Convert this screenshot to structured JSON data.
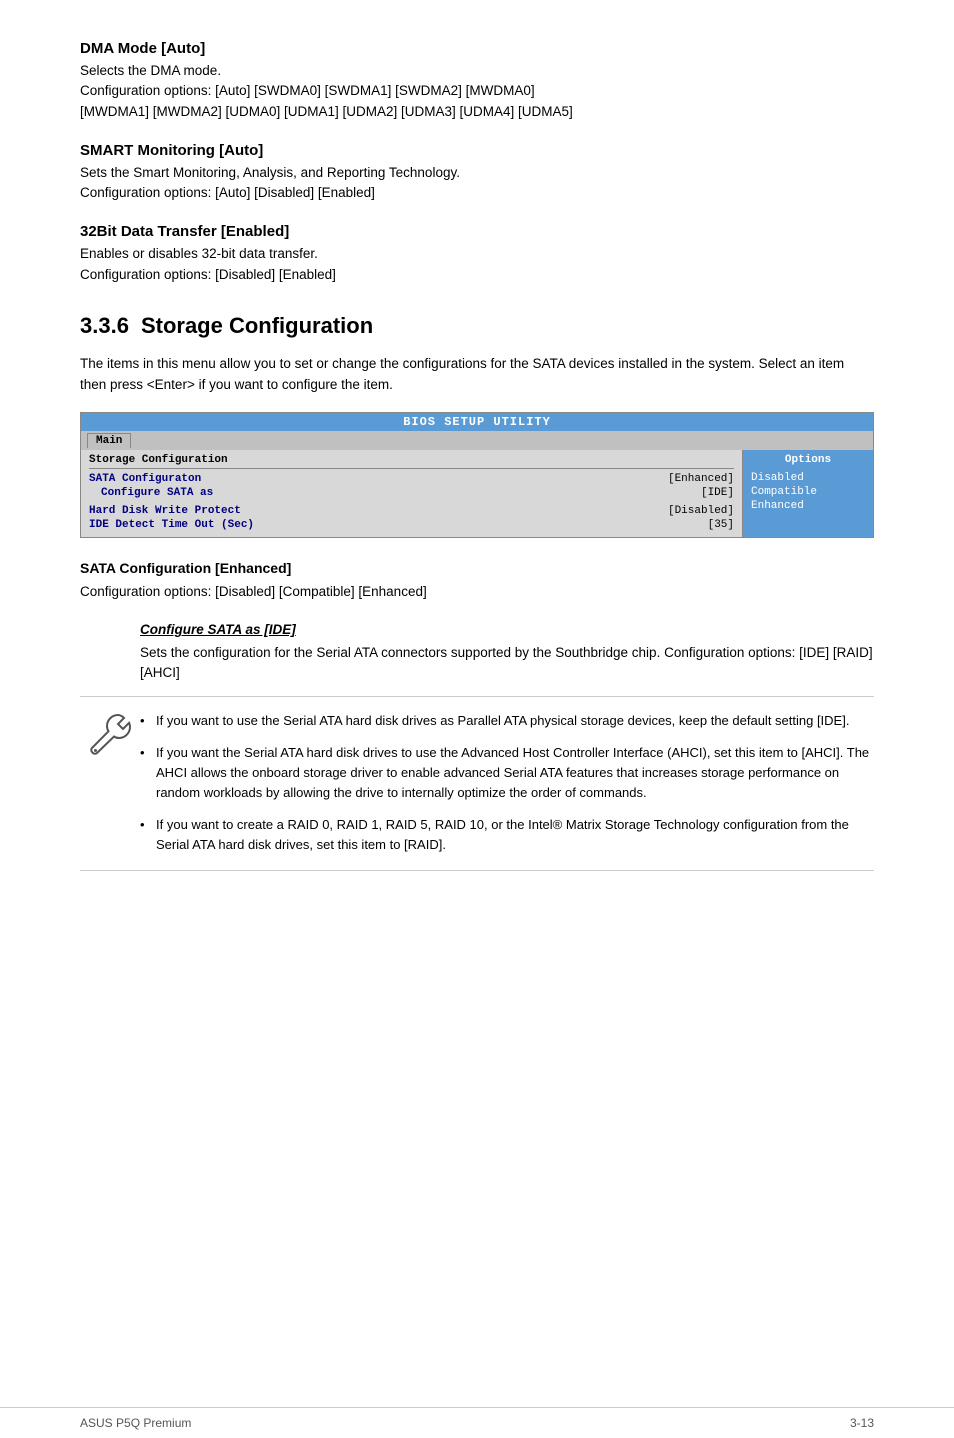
{
  "dma_section": {
    "heading": "DMA Mode [Auto]",
    "body_line1": "Selects the DMA mode.",
    "body_line2": "Configuration options: [Auto] [SWDMA0] [SWDMA1] [SWDMA2] [MWDMA0]",
    "body_line3": "[MWDMA1] [MWDMA2] [UDMA0] [UDMA1] [UDMA2] [UDMA3] [UDMA4] [UDMA5]"
  },
  "smart_section": {
    "heading": "SMART Monitoring [Auto]",
    "body_line1": "Sets the Smart Monitoring, Analysis, and Reporting Technology.",
    "body_line2": "Configuration options: [Auto] [Disabled] [Enabled]"
  },
  "bit32_section": {
    "heading": "32Bit Data Transfer [Enabled]",
    "body_line1": "Enables or disables 32-bit data transfer.",
    "body_line2": "Configuration options: [Disabled] [Enabled]"
  },
  "storage_section": {
    "number": "3.3.6",
    "title": "Storage Configuration",
    "intro": "The items in this menu allow you to set or change the configurations for the SATA devices installed in the system. Select an item then press <Enter> if you want to configure the item."
  },
  "bios_ui": {
    "title": "BIOS SETUP UTILITY",
    "menu_tab": "Main",
    "section_label": "Storage Configuration",
    "options_label": "Options",
    "rows": [
      {
        "label": "SATA Configuraton",
        "value": "[Enhanced]",
        "sublabel": "Configure SATA as",
        "subvalue": "[IDE]"
      },
      {
        "label": "Hard Disk Write Protect",
        "value": "[Disabled]",
        "sublabel": "IDE Detect Time Out (Sec)",
        "subvalue": "[35]"
      }
    ],
    "options": [
      "Disabled",
      "Compatible",
      "Enhanced"
    ]
  },
  "sata_section": {
    "heading": "SATA Configuration [Enhanced]",
    "config_options": "Configuration options: [Disabled] [Compatible] [Enhanced]",
    "configure_label": "Configure SATA as [IDE]",
    "configure_body": "Sets the configuration for the Serial ATA connectors supported by the Southbridge chip. Configuration options: [IDE] [RAID] [AHCI]"
  },
  "notes": [
    "If you want to use the Serial ATA hard disk drives as Parallel ATA physical storage devices, keep the default setting [IDE].",
    "If you want the Serial ATA hard disk drives to use the Advanced Host Controller Interface (AHCI), set this item to [AHCI]. The AHCI allows the onboard storage driver to enable advanced Serial ATA features that increases storage performance on random workloads by allowing the drive to internally optimize the order of commands.",
    "If you want to create a RAID 0, RAID 1, RAID 5, RAID 10, or the Intel® Matrix Storage Technology configuration from the Serial ATA hard disk drives, set this item to [RAID]."
  ],
  "footer": {
    "left": "ASUS P5Q Premium",
    "right": "3-13"
  }
}
